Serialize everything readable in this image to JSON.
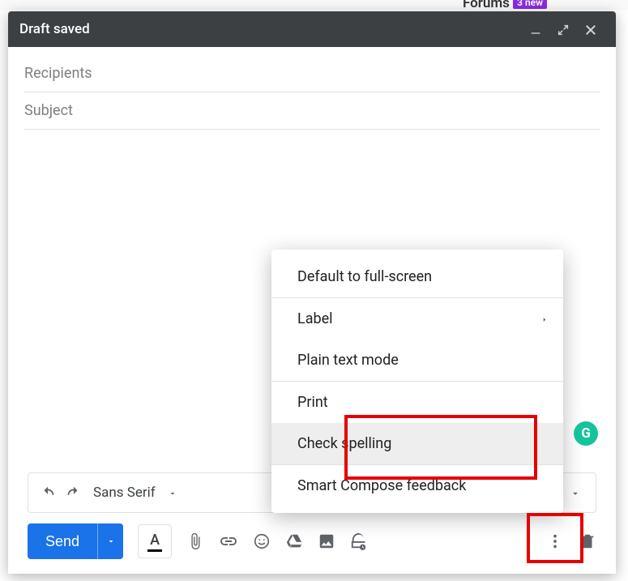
{
  "background": {
    "forums_label": "Forums",
    "new_badge": "3 new"
  },
  "titlebar": {
    "title": "Draft saved"
  },
  "fields": {
    "recipients_placeholder": "Recipients",
    "subject_placeholder": "Subject"
  },
  "format_bar": {
    "font": "Sans Serif"
  },
  "bottom_bar": {
    "send_label": "Send"
  },
  "overflow_menu": {
    "items": {
      "fullscreen": "Default to full-screen",
      "label": "Label",
      "plaintext": "Plain text mode",
      "print": "Print",
      "check_spelling": "Check spelling",
      "smart_compose": "Smart Compose feedback"
    }
  },
  "badges": {
    "grammarly": "G"
  }
}
